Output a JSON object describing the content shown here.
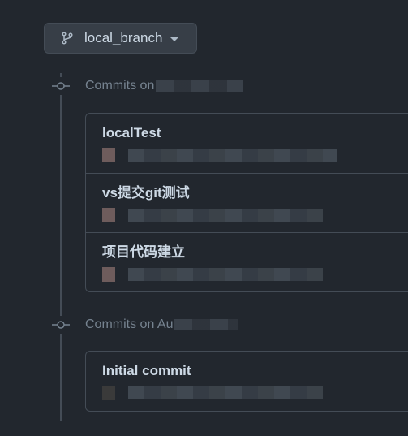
{
  "branch_selector": {
    "label": "local_branch",
    "icon": "git-branch-icon",
    "caret_icon": "triangle-down-icon"
  },
  "groups": [
    {
      "title": "Commits on",
      "commits": [
        {
          "title": "localTest"
        },
        {
          "title": "vs提交git测试"
        },
        {
          "title": "项目代码建立"
        }
      ]
    },
    {
      "title": "Commits on Au",
      "commits": [
        {
          "title": "Initial commit"
        }
      ]
    }
  ],
  "colors": {
    "background": "#22272e",
    "border": "#444c56",
    "text_primary": "#cdd9e5",
    "text_muted": "#768390"
  }
}
